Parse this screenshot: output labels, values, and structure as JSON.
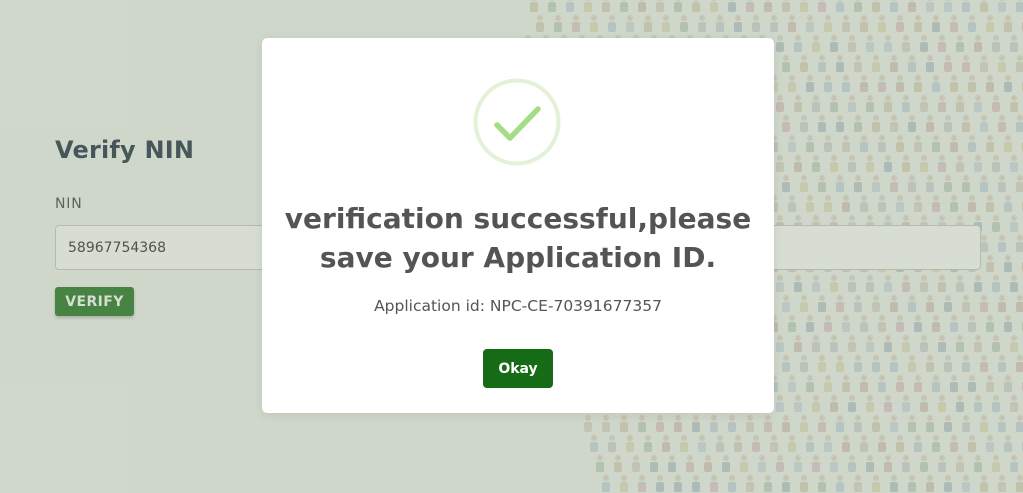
{
  "form": {
    "title": "Verify NIN",
    "nin_label": "NIN",
    "nin_value": "58967754368",
    "verify_label": "VERIFY"
  },
  "modal": {
    "icon": "success-check-icon",
    "title": "verification successful,please save your Application ID.",
    "text": "Application id: NPC-CE-70391677357",
    "okay_label": "Okay"
  },
  "colors": {
    "primary_button": "#186e18",
    "success_ring": "#e3f1d9",
    "success_check": "#a5dc86",
    "title_text": "#545454",
    "form_title": "#16263a"
  }
}
